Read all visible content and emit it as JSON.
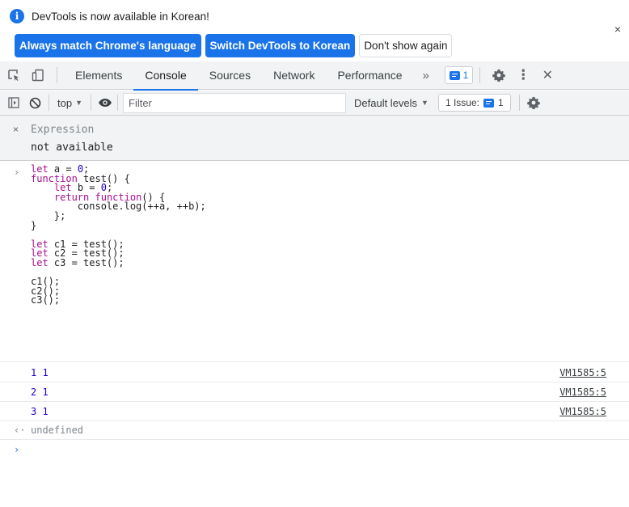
{
  "infobar": {
    "message": "DevTools is now available in Korean!",
    "info_icon": "i",
    "close_icon": "×",
    "buttons": [
      "Always match Chrome's language",
      "Switch DevTools to Korean",
      "Don't show again"
    ]
  },
  "tabs": {
    "items": [
      "Elements",
      "Console",
      "Sources",
      "Network",
      "Performance"
    ],
    "active": "Console",
    "overflow_icon": "»",
    "message_badge_count": "1",
    "settings_icon": "gear-icon",
    "menu_icon": "⋮",
    "close_icon": "✕"
  },
  "console_toolbar": {
    "context": "top",
    "filter_placeholder": "Filter",
    "levels": "Default levels",
    "issues_label": "1 Issue:",
    "issues_count": "1"
  },
  "live_expression": {
    "close": "×",
    "label": "Expression",
    "value": "not available"
  },
  "input_code": {
    "prompt": "›",
    "lines": [
      "let a = 0;",
      "function test() {",
      "    let b = 0;",
      "    return function() {",
      "        console.log(++a, ++b);",
      "    };",
      "}",
      "",
      "let c1 = test();",
      "let c2 = test();",
      "let c3 = test();",
      "",
      "c1();",
      "c2();",
      "c3();"
    ]
  },
  "logs": [
    {
      "value": "1 1",
      "source": "VM1585:5"
    },
    {
      "value": "2 1",
      "source": "VM1585:5"
    },
    {
      "value": "3 1",
      "source": "VM1585:5"
    }
  ],
  "result": {
    "arrow": "‹·",
    "value": "undefined"
  },
  "next_prompt": "›",
  "colors": {
    "accent": "#1a73e8",
    "keyword": "#aa0d91",
    "number": "#1c00cf",
    "toolbar_bg": "#f1f3f4"
  }
}
